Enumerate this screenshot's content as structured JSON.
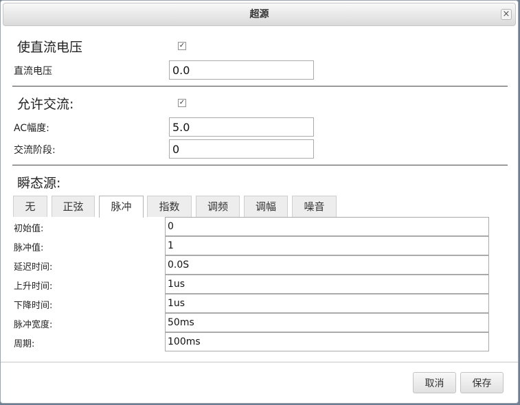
{
  "dialog": {
    "title": "超源",
    "close_label": "×"
  },
  "dc": {
    "enable_label": "使直流电压",
    "enable_checked": true,
    "voltage_label": "直流电压",
    "voltage_value": "0.0"
  },
  "ac": {
    "enable_label": "允许交流:",
    "enable_checked": true,
    "amplitude_label": "AC幅度:",
    "amplitude_value": "5.0",
    "phase_label": "交流阶段:",
    "phase_value": "0"
  },
  "transient": {
    "title": "瞬态源:",
    "tabs": [
      {
        "label": "无",
        "active": false
      },
      {
        "label": "正弦",
        "active": false
      },
      {
        "label": "脉冲",
        "active": true
      },
      {
        "label": "指数",
        "active": false
      },
      {
        "label": "调频",
        "active": false
      },
      {
        "label": "调幅",
        "active": false
      },
      {
        "label": "噪音",
        "active": false
      }
    ],
    "fields": [
      {
        "label": "初始值:",
        "value": "0"
      },
      {
        "label": "脉冲值:",
        "value": "1"
      },
      {
        "label": "延迟时间:",
        "value": "0.0S"
      },
      {
        "label": "上升时间:",
        "value": "1us"
      },
      {
        "label": "下降时间:",
        "value": "1us"
      },
      {
        "label": "脉冲宽度:",
        "value": "50ms"
      },
      {
        "label": "周期:",
        "value": "100ms"
      }
    ]
  },
  "footer": {
    "cancel_label": "取消",
    "save_label": "保存"
  },
  "colors": {
    "background": "#6e7f93",
    "dialog": "#ffffff",
    "active_tab": "#ffffff",
    "inactive_tab": "#ededed"
  }
}
